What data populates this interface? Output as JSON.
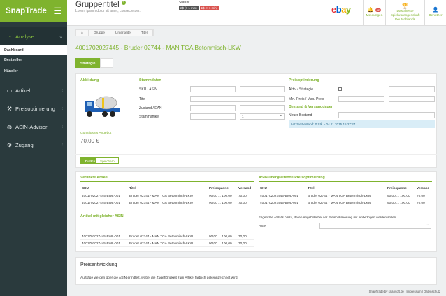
{
  "app": {
    "brand": "SnapTrade",
    "menu_icon": "hamburger-icon"
  },
  "nav": {
    "items": [
      {
        "label": "Analyse",
        "icon": "dashboard-icon"
      },
      {
        "label": "Artikel",
        "icon": "folder-icon"
      },
      {
        "label": "Preisoptimierung",
        "icon": "gavel-icon"
      },
      {
        "label": "ASIN-Advisor",
        "icon": "globe-icon"
      },
      {
        "label": "Zugang",
        "icon": "gears-icon"
      }
    ],
    "sub": {
      "dashboard": "Dashboard",
      "bestseller": "Bestseller",
      "haendler": "Händler"
    }
  },
  "header": {
    "title": "Gruppentitel",
    "subtitle": "Lorem ipsum dolor sit amet, consectetuer.",
    "status_label": "Status:",
    "badge1": "£$ (> 1 min)",
    "badge2": "£$ (> 1 min)",
    "ebay": [
      "e",
      "b",
      "a",
      "y"
    ],
    "meldungen": "Meldungen",
    "meldungen_count": "42",
    "award": "Das älteste Spielwarengeschäft Deutschlands",
    "benutzer": "Benutzer"
  },
  "breadcrumbs": [
    "Gruppe",
    "Unterseite",
    "Titel"
  ],
  "page_title": "4001702027445 - Bruder 02744 - MAN TGA Betonmisch-LKW",
  "tabs": [
    "Strategie",
    "..."
  ],
  "form": {
    "abbildung": "Abbildung",
    "guenstigstes_label": "Günstigstes Angebot",
    "guenstigstes_value": "70,00 €",
    "stammdaten": "Stammdaten",
    "sku": "SKU / ASIN",
    "titel": "Titel",
    "zustand": "Zustand / EAN",
    "stammartikel": "Stammartikel",
    "stammartikel_value": "1",
    "preisopt": "Preisoptimierung",
    "aktiv": "Aktiv / Strategie",
    "minmax": "Min.-Preis / Max.-Preis",
    "bestand_head": "Bestand & Versanddauer",
    "neuer_bestand": "Neuer Bestand",
    "letzter": "Letzter Bestand: 0 Stk. - 04.11.2015 15:27:27",
    "btn_back": "Zurück",
    "btn_save": "Speichern"
  },
  "linked": {
    "title": "Verlinkte Artikel",
    "cols": [
      "SKU",
      "Titel",
      "Preisspanne",
      "Versand"
    ],
    "rows": [
      [
        "4001702027445-BWL-001",
        "Bruder 02744 - MAN TGA Betonmisch-LKW",
        "90,00 ... 100,00",
        "70,00"
      ],
      [
        "4001702027445-BWL-001",
        "Bruder 02744 - MAN TGA Betonmisch-LKW",
        "90,00 ... 100,00",
        "70,00"
      ]
    ]
  },
  "same_asin": {
    "title": "Artikel mit gleicher ASIN",
    "rows": [
      [
        "4001702027445-BWL-001",
        "Bruder 02744 - MAN TGA Betonmisch-LKW",
        "90,00 ... 100,00",
        "70,00"
      ],
      [
        "4001702027445-BWL-001",
        "Bruder 02744 - MAN TGA Betonmisch-LKW",
        "90,00 ... 100,00",
        "70,00"
      ]
    ]
  },
  "asin_opt": {
    "title": "ASIN-übergreifende Preisoptimierung",
    "cols": [
      "SKU",
      "Titel",
      "Preisspanne",
      "Versand"
    ],
    "rows": [
      [
        "4001702027445-BWL-001",
        "Bruder 02744 - MAN TGA Betonmisch-LKW",
        "90,00 ... 100,00",
        "70,00"
      ],
      [
        "4001702027445-BWL-001",
        "Bruder 02744 - MAN TGA Betonmisch-LKW",
        "90,00 ... 100,00",
        "70,00"
      ]
    ],
    "hint": "Fügen Sie ASIN's hinzu, deren Angebote bei der Preisoptimierung mit einbezogen werden sollen.",
    "asin_label": "ASIN"
  },
  "preis": {
    "title": "Preisentwicklung",
    "text": "Aufträge werden über die ASIN ermittelt, wobei die Zugehörigkeit zum Artikel farblich gekennzeichnet wird."
  },
  "footer": "SnapTrade by snapsoft.de | Impressum | Datenschutz"
}
